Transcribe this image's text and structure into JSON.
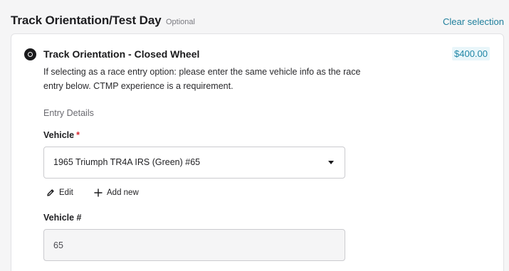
{
  "section": {
    "title": "Track Orientation/Test Day",
    "optional_label": "Optional",
    "clear_label": "Clear selection"
  },
  "option": {
    "title": "Track Orientation - Closed Wheel",
    "price": "$400.00",
    "selected": true,
    "description_line1": "If selecting as a race entry option: please enter the same vehicle info as the race",
    "description_line2": "entry below. CTMP experience is a requirement."
  },
  "entry": {
    "heading": "Entry Details",
    "vehicle_label": "Vehicle",
    "required_mark": "*",
    "vehicle_value": "1965 Triumph TR4A IRS (Green) #65",
    "edit_label": "Edit",
    "add_label": "Add new",
    "vehicle_number_label": "Vehicle #",
    "vehicle_number_value": "65"
  },
  "icons": {
    "edit": "pencil-icon",
    "add": "plus-icon",
    "select": "chevron-down-icon",
    "radio": "radio-selected-icon"
  },
  "colors": {
    "accent": "#1f7f9c",
    "price_bg": "#e9f6fa",
    "required": "#d6262e"
  }
}
